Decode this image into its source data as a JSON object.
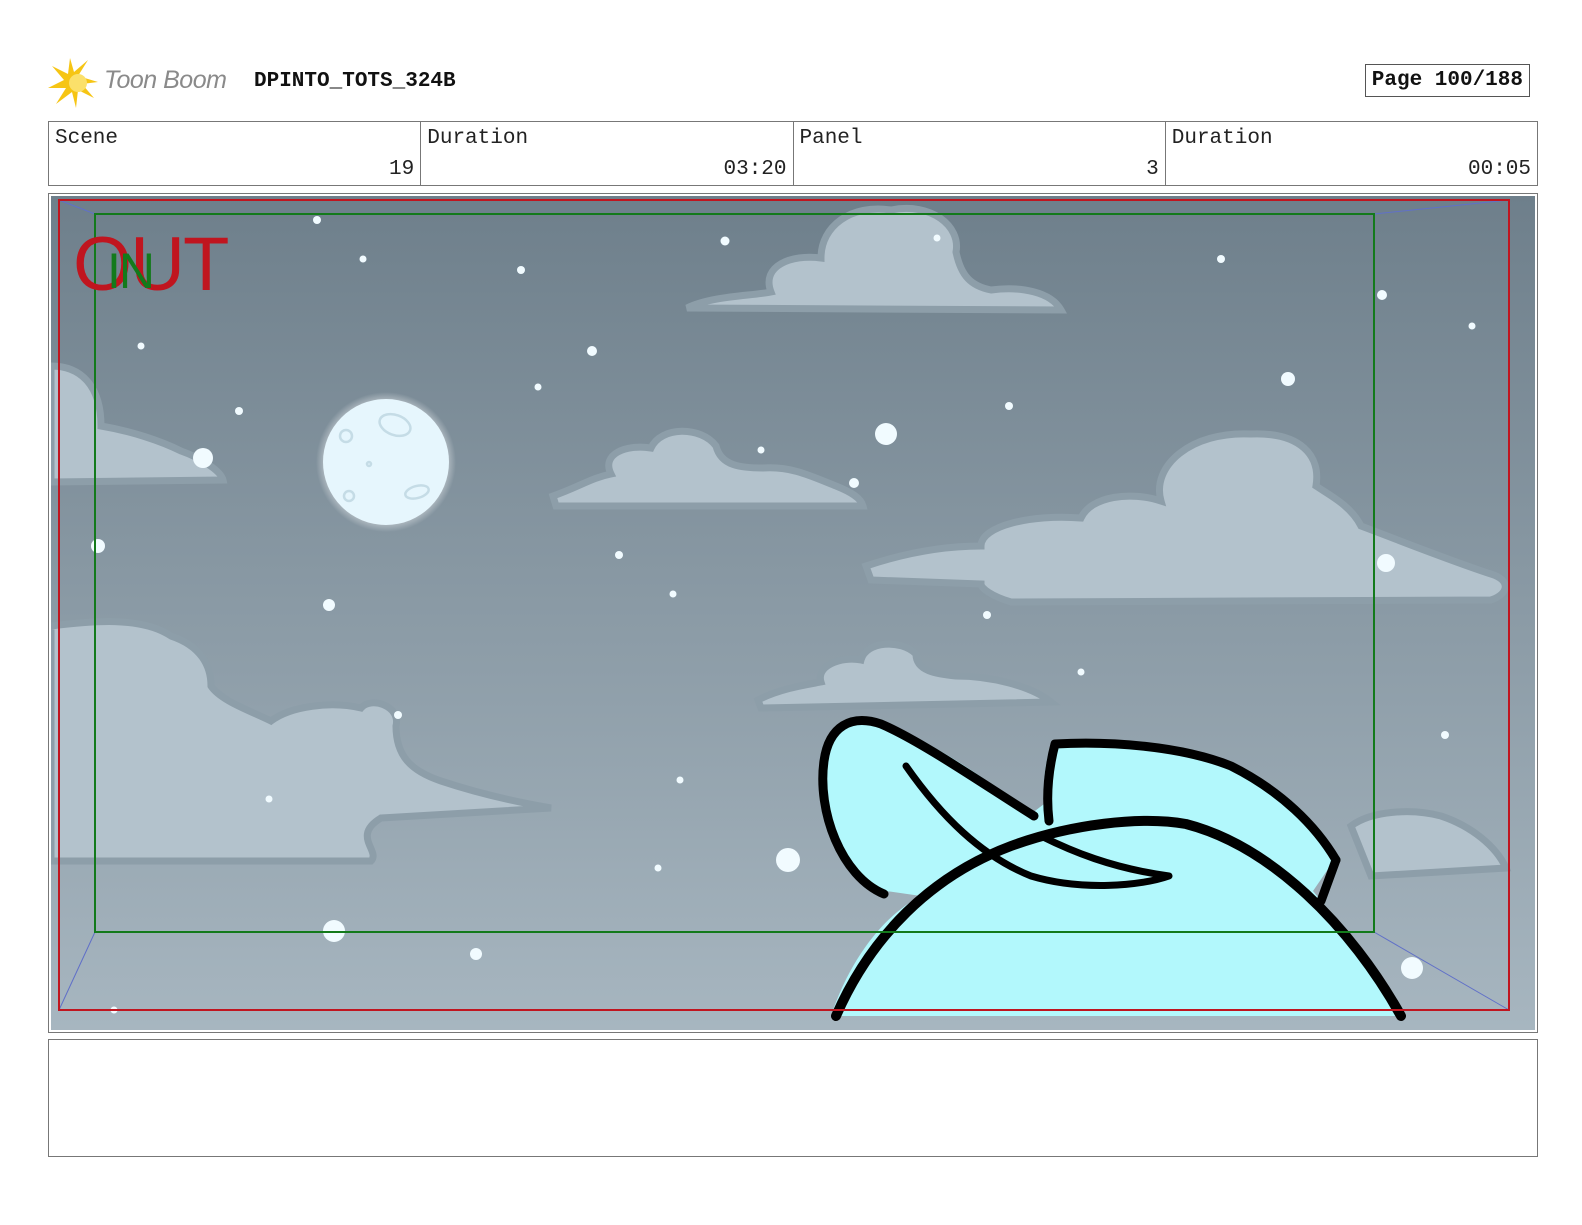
{
  "header": {
    "logo_text": "Toon Boom",
    "project": "DPINTO_TOTS_324B",
    "page": "Page 100/188"
  },
  "info": {
    "scene_label": "Scene",
    "scene_value": "19",
    "scene_duration_label": "Duration",
    "scene_duration_value": "03:20",
    "panel_label": "Panel",
    "panel_value": "3",
    "panel_duration_label": "Duration",
    "panel_duration_value": "00:05"
  },
  "panel": {
    "out_label": "OUT",
    "in_label": "IN",
    "colors": {
      "sky_top": "#6e7f8b",
      "sky_bottom": "#a7b6c0",
      "cloud": "#b3c2cc",
      "cloud_outline": "#8d9ea9",
      "moon": "#e6f6fd",
      "character_fill": "#b2f8fc",
      "out_frame": "#c0151f",
      "in_frame": "#137a1b"
    }
  },
  "notes": {
    "text": ""
  }
}
